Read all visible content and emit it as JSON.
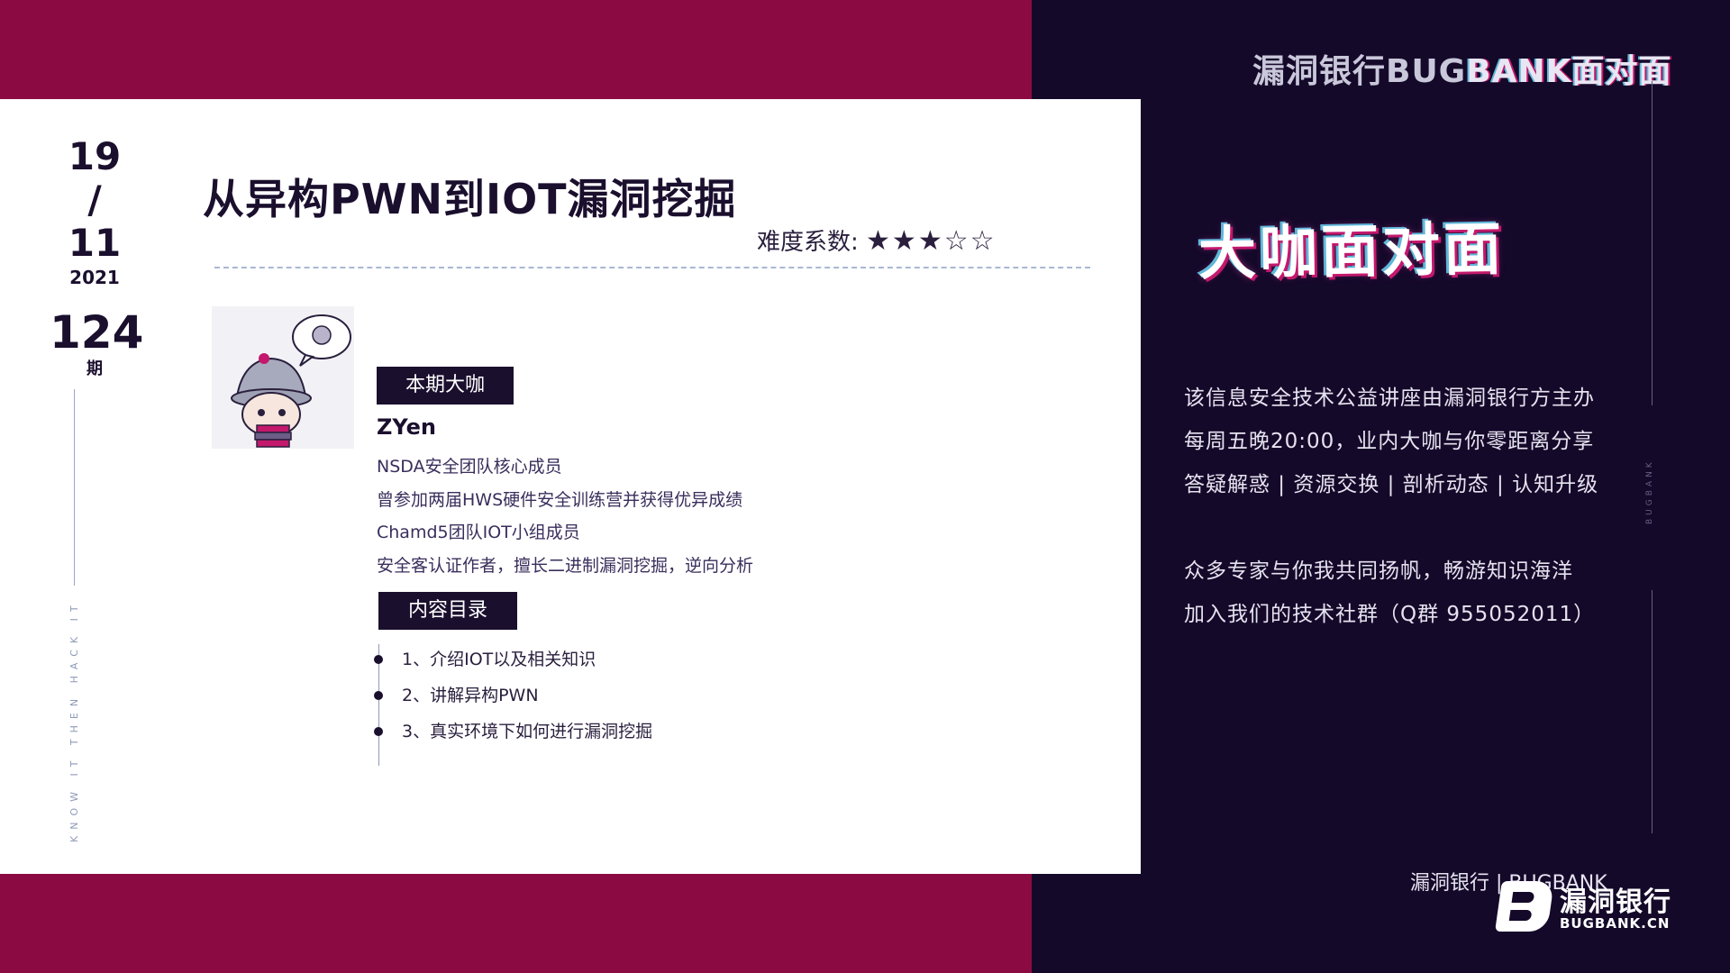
{
  "date": {
    "day": "19",
    "slash": "/",
    "month": "11",
    "year": "2021",
    "issue": "124",
    "issue_unit": "期"
  },
  "slogan": "KNOW IT THEN HACK IT",
  "title": "从异构PWN到IOT漏洞挖掘",
  "difficulty": {
    "label": "难度系数:",
    "stars": "★★★☆☆",
    "filled": 3,
    "max": 5
  },
  "guest": {
    "tag": "本期大咖",
    "name": "ZYen",
    "bio": [
      "NSDA安全团队核心成员",
      "曾参加两届HWS硬件安全训练营并获得优异成绩",
      "Chamd5团队IOT小组成员",
      "安全客认证作者，擅长二进制漏洞挖掘，逆向分析"
    ]
  },
  "toc": {
    "tag": "内容目录",
    "items": [
      "1、介绍IOT以及相关知识",
      "2、讲解异构PWN",
      "3、真实环境下如何进行漏洞挖掘"
    ]
  },
  "brand": {
    "top_main": "漏洞银行BUG",
    "top_accent": "BANK面对面",
    "logo_big": "大咖面对面",
    "vertical": "BUGBANK"
  },
  "description": [
    "该信息安全技术公益讲座由漏洞银行方主办",
    "每周五晚20:00，业内大咖与你零距离分享",
    "答疑解惑 | 资源交换 | 剖析动态 | 认知升级",
    "",
    "众多专家与你我共同扬帆，畅游知识海洋",
    "加入我们的技术社群（Q群 955052011）"
  ],
  "footer": {
    "text": "漏洞银行 | BUGBANK",
    "logo_cn": "漏洞银行",
    "logo_en": "BUGBANK.CN"
  },
  "colors": {
    "crimson": "#8c0a42",
    "navy": "#15092a",
    "card": "#ffffff",
    "accent_pink": "#c3186c",
    "accent_cyan": "#5fb7d9"
  }
}
